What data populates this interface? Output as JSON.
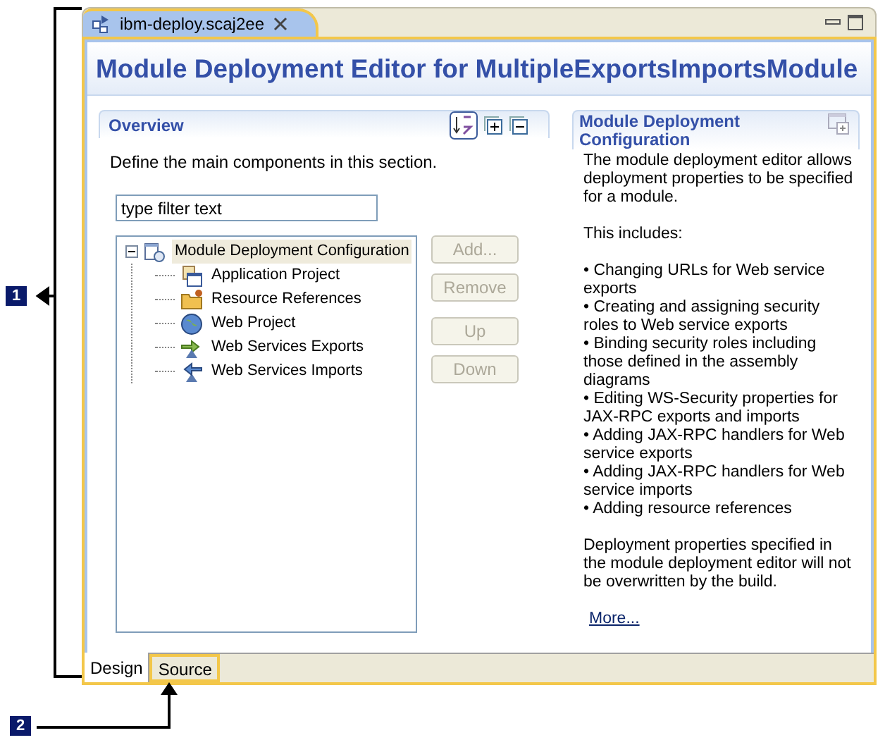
{
  "editor_tab": {
    "label": "ibm-deploy.scaj2ee"
  },
  "title": "Module Deployment Editor for MultipleExportsImportsModule",
  "overview": {
    "heading": "Overview",
    "description": "Define the main components in this section.",
    "filter": {
      "value": "type filter text"
    },
    "tree": [
      {
        "label": "Module Deployment Configuration",
        "kind": "config",
        "expanded": true,
        "selected": true,
        "children": [
          {
            "label": "Application Project",
            "kind": "application",
            "selected": false
          },
          {
            "label": "Resource References",
            "kind": "folder",
            "selected": false
          },
          {
            "label": "Web Project",
            "kind": "globe",
            "selected": false
          },
          {
            "label": "Web Services Exports",
            "kind": "export",
            "selected": false
          },
          {
            "label": "Web Services Imports",
            "kind": "import",
            "selected": false
          }
        ]
      }
    ],
    "buttons": [
      {
        "label": "Add...",
        "disabled": true
      },
      {
        "label": "Remove",
        "disabled": true
      },
      {
        "label": "Up",
        "disabled": true
      },
      {
        "label": "Down",
        "disabled": true
      }
    ]
  },
  "details": {
    "heading": "Module Deployment Configuration",
    "intro": "The module deployment editor allows deployment properties to be specified for a module.",
    "includes": "This includes:",
    "bullets": [
      "• Changing URLs for Web service exports",
      "• Creating and assigning security roles to Web service exports",
      "• Binding security roles including those defined in the assembly diagrams",
      "• Editing WS-Security properties for JAX-RPC exports and imports",
      "• Adding JAX-RPC handlers for Web service exports",
      "• Adding JAX-RPC handlers for Web service imports",
      "• Adding resource references"
    ],
    "closing": "Deployment properties specified in the module deployment editor will not be overwritten by the build.",
    "link": "More..."
  },
  "bottom_tabs": [
    {
      "label": "Design",
      "selected": true
    },
    {
      "label": "Source",
      "selected": false
    }
  ],
  "callouts": [
    {
      "label": "1"
    },
    {
      "label": "2"
    }
  ]
}
